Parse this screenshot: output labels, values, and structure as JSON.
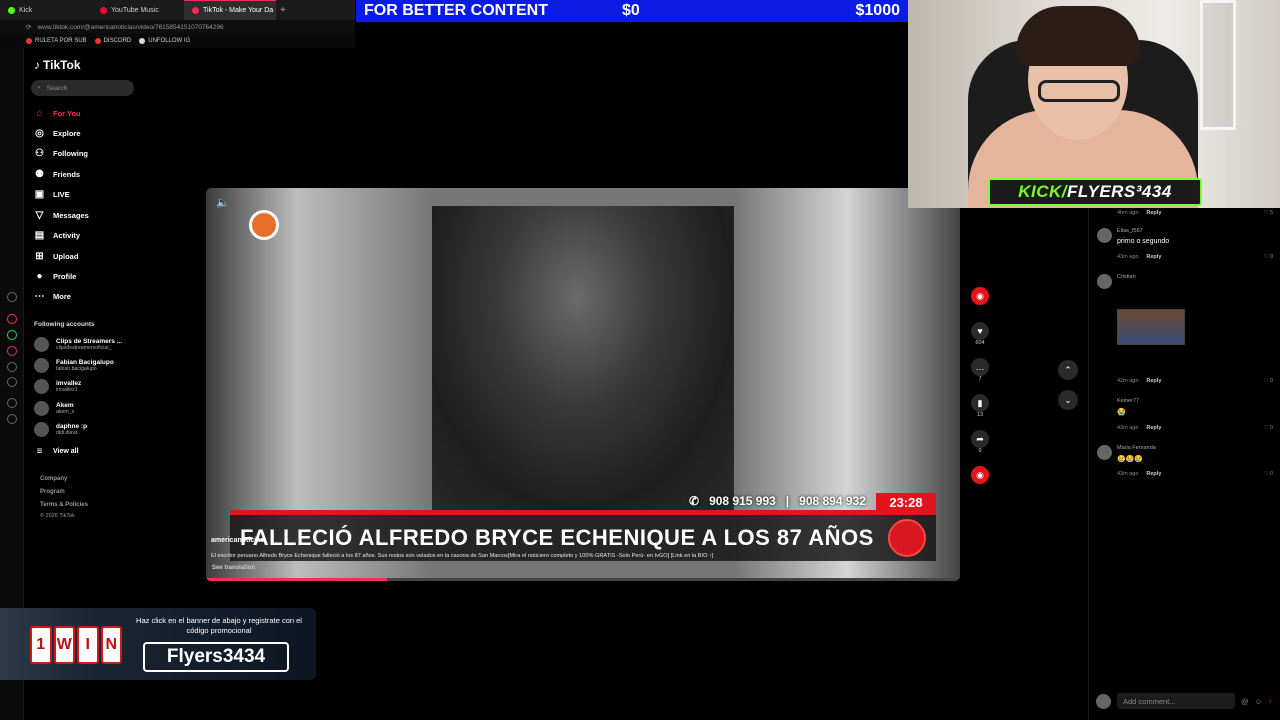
{
  "browser": {
    "tabs": [
      {
        "label": "Kick",
        "color": "#53fc18",
        "active": false
      },
      {
        "label": "YouTube Music",
        "color": "#ff0033",
        "active": false
      },
      {
        "label": "TikTok - Make Your Da",
        "color": "#fe2c55",
        "active": true
      }
    ],
    "new_tab": "+",
    "url": "www.tiktok.com/@americanoticias/video/7615854151070764296",
    "bookmarks": [
      "RULETA POR SUB",
      "DISCORD",
      "UNFOLLOW IG"
    ]
  },
  "donation_bar": {
    "title": "FOR BETTER CONTENT",
    "current": "$0",
    "goal": "$1000"
  },
  "tiktok": {
    "logo": "TikTok",
    "search_placeholder": "Search",
    "nav": [
      {
        "label": "For You",
        "icon": "home-icon",
        "active": true
      },
      {
        "label": "Explore",
        "icon": "compass-icon"
      },
      {
        "label": "Following",
        "icon": "following-icon"
      },
      {
        "label": "Friends",
        "icon": "friends-icon"
      },
      {
        "label": "LIVE",
        "icon": "live-icon"
      },
      {
        "label": "Messages",
        "icon": "messages-icon"
      },
      {
        "label": "Activity",
        "icon": "activity-icon"
      },
      {
        "label": "Upload",
        "icon": "upload-icon"
      },
      {
        "label": "Profile",
        "icon": "profile-icon"
      },
      {
        "label": "More",
        "icon": "more-icon"
      }
    ],
    "following_header": "Following accounts",
    "following": [
      {
        "name": "Clips de Streamers ...",
        "handle": "clipsdestreamersoficial_"
      },
      {
        "name": "Fabian Bacigalupo",
        "handle": "fabian.bacigalupo"
      },
      {
        "name": "imvallez",
        "handle": "imvallez1"
      },
      {
        "name": "Akem",
        "handle": "akem_x"
      },
      {
        "name": "daphne :p",
        "handle": "didi.diavz"
      }
    ],
    "view_all": "View all",
    "footer": [
      "Company",
      "Program",
      "Terms & Policies",
      "© 2026 TikTok"
    ]
  },
  "video": {
    "phones": [
      "908 915 993",
      "908 894 932"
    ],
    "time": "23:28",
    "headline": "FALLECIÓ ALFREDO BRYCE ECHENIQUE A LOS 87 AÑOS",
    "author": "americanoticias",
    "caption": "El escritor peruano Alfredo Bryce Echenique falleció a los 87 años. Sus restos son velados en la casona de San Marcos[Mira el noticiero completo y 100% GRATIS -Solo Perú- en tvGO] [Link en la BIO ↑]",
    "see_translation": "See translation",
    "progress": 0.24
  },
  "actions": {
    "likes": "604",
    "comments": "7",
    "saves": "13",
    "shares": "9"
  },
  "comments": [
    {
      "user": "",
      "text": "",
      "time": "4hm ago",
      "reply": "Reply",
      "likes": "5"
    },
    {
      "user": "Elias_f567",
      "text": "primo o segundo",
      "time": "43m ago",
      "reply": "Reply",
      "likes": "0"
    },
    {
      "user": "Cristian",
      "text": "",
      "time": "42m ago",
      "reply": "Reply",
      "likes": "0"
    },
    {
      "user": "Keiner77",
      "text": "😭",
      "time": "43m ago",
      "reply": "Reply",
      "likes": "0"
    },
    {
      "user": "Maria Fernanda",
      "text": "😢😢😢",
      "time": "43m ago",
      "reply": "Reply",
      "likes": "0"
    }
  ],
  "add_comment_placeholder": "Add comment...",
  "webcam": {
    "label_prefix": "KICK/",
    "label_name": "FLYERS³434"
  },
  "banner": {
    "brand_letters": [
      "1",
      "W",
      "I",
      "N"
    ],
    "text": "Haz click en el banner de abajo y registrate con el código promocional",
    "code": "Flyers3434"
  }
}
